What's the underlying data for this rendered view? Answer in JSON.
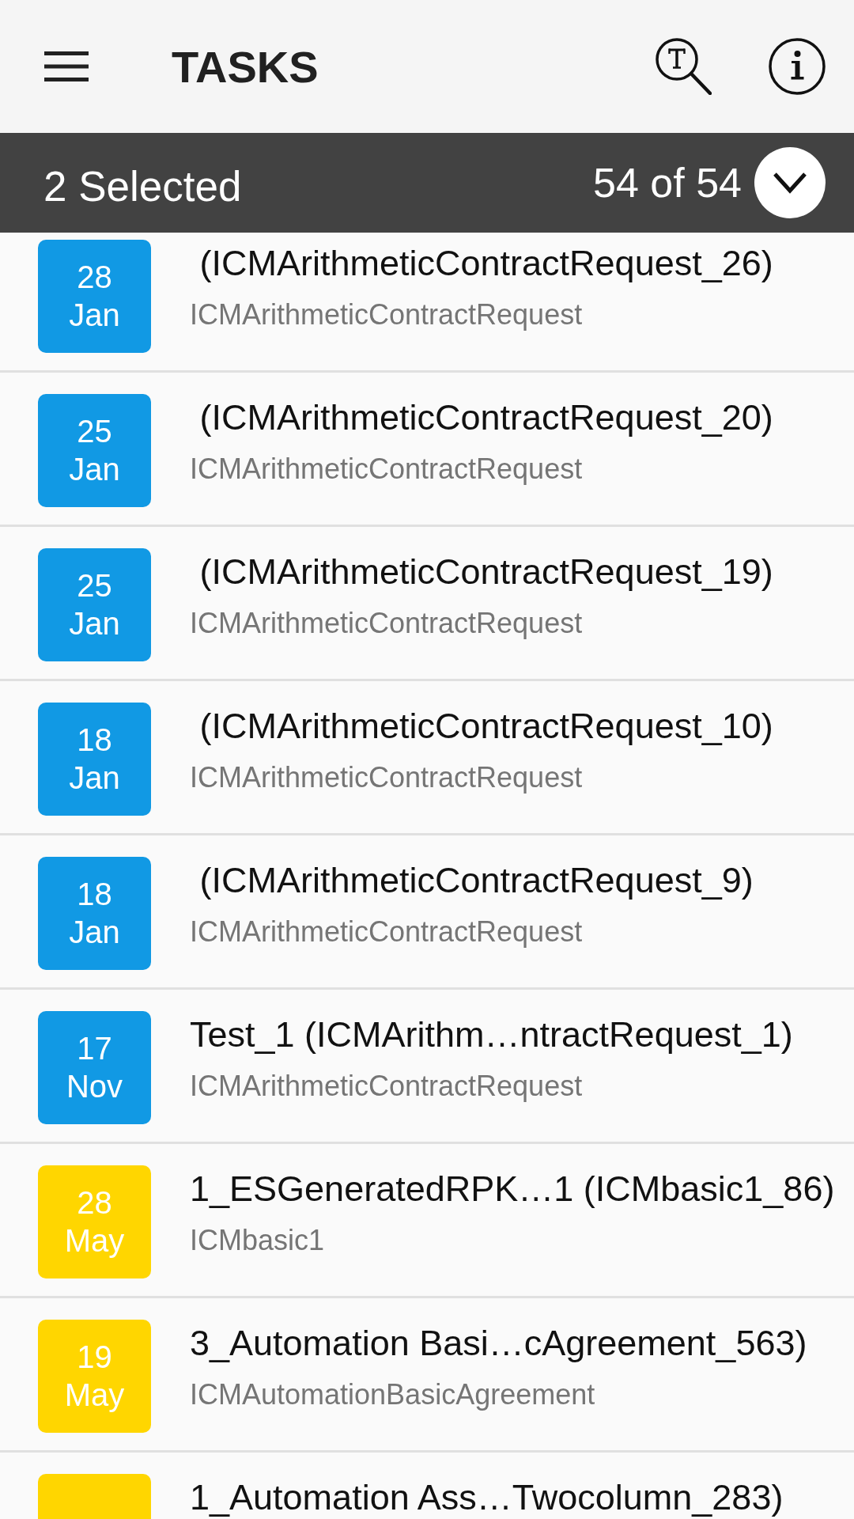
{
  "app_bar": {
    "title": "TASKS"
  },
  "selection_bar": {
    "label": "2 Selected",
    "count": "54 of 54"
  },
  "tasks": [
    {
      "day": "28",
      "month": "Jan",
      "color": "#1199e4",
      "title": " (ICMArithmeticContractRequest_26)",
      "subtitle": "ICMArithmeticContractRequest"
    },
    {
      "day": "25",
      "month": "Jan",
      "color": "#1199e4",
      "title": " (ICMArithmeticContractRequest_20)",
      "subtitle": "ICMArithmeticContractRequest"
    },
    {
      "day": "25",
      "month": "Jan",
      "color": "#1199e4",
      "title": " (ICMArithmeticContractRequest_19)",
      "subtitle": "ICMArithmeticContractRequest"
    },
    {
      "day": "18",
      "month": "Jan",
      "color": "#1199e4",
      "title": " (ICMArithmeticContractRequest_10)",
      "subtitle": "ICMArithmeticContractRequest"
    },
    {
      "day": "18",
      "month": "Jan",
      "color": "#1199e4",
      "title": " (ICMArithmeticContractRequest_9)",
      "subtitle": "ICMArithmeticContractRequest"
    },
    {
      "day": "17",
      "month": "Nov",
      "color": "#1199e4",
      "title": "Test_1 (ICMArithm…ntractRequest_1)",
      "subtitle": "ICMArithmeticContractRequest"
    },
    {
      "day": "28",
      "month": "May",
      "color": "#ffd600",
      "title": "1_ESGeneratedRPK…1 (ICMbasic1_86)",
      "subtitle": "ICMbasic1"
    },
    {
      "day": "19",
      "month": "May",
      "color": "#ffd600",
      "title": "3_Automation Basi…cAgreement_563)",
      "subtitle": "ICMAutomationBasicAgreement"
    },
    {
      "color": "#ffd600",
      "title": "1_Automation Ass…Twocolumn_283)"
    }
  ]
}
